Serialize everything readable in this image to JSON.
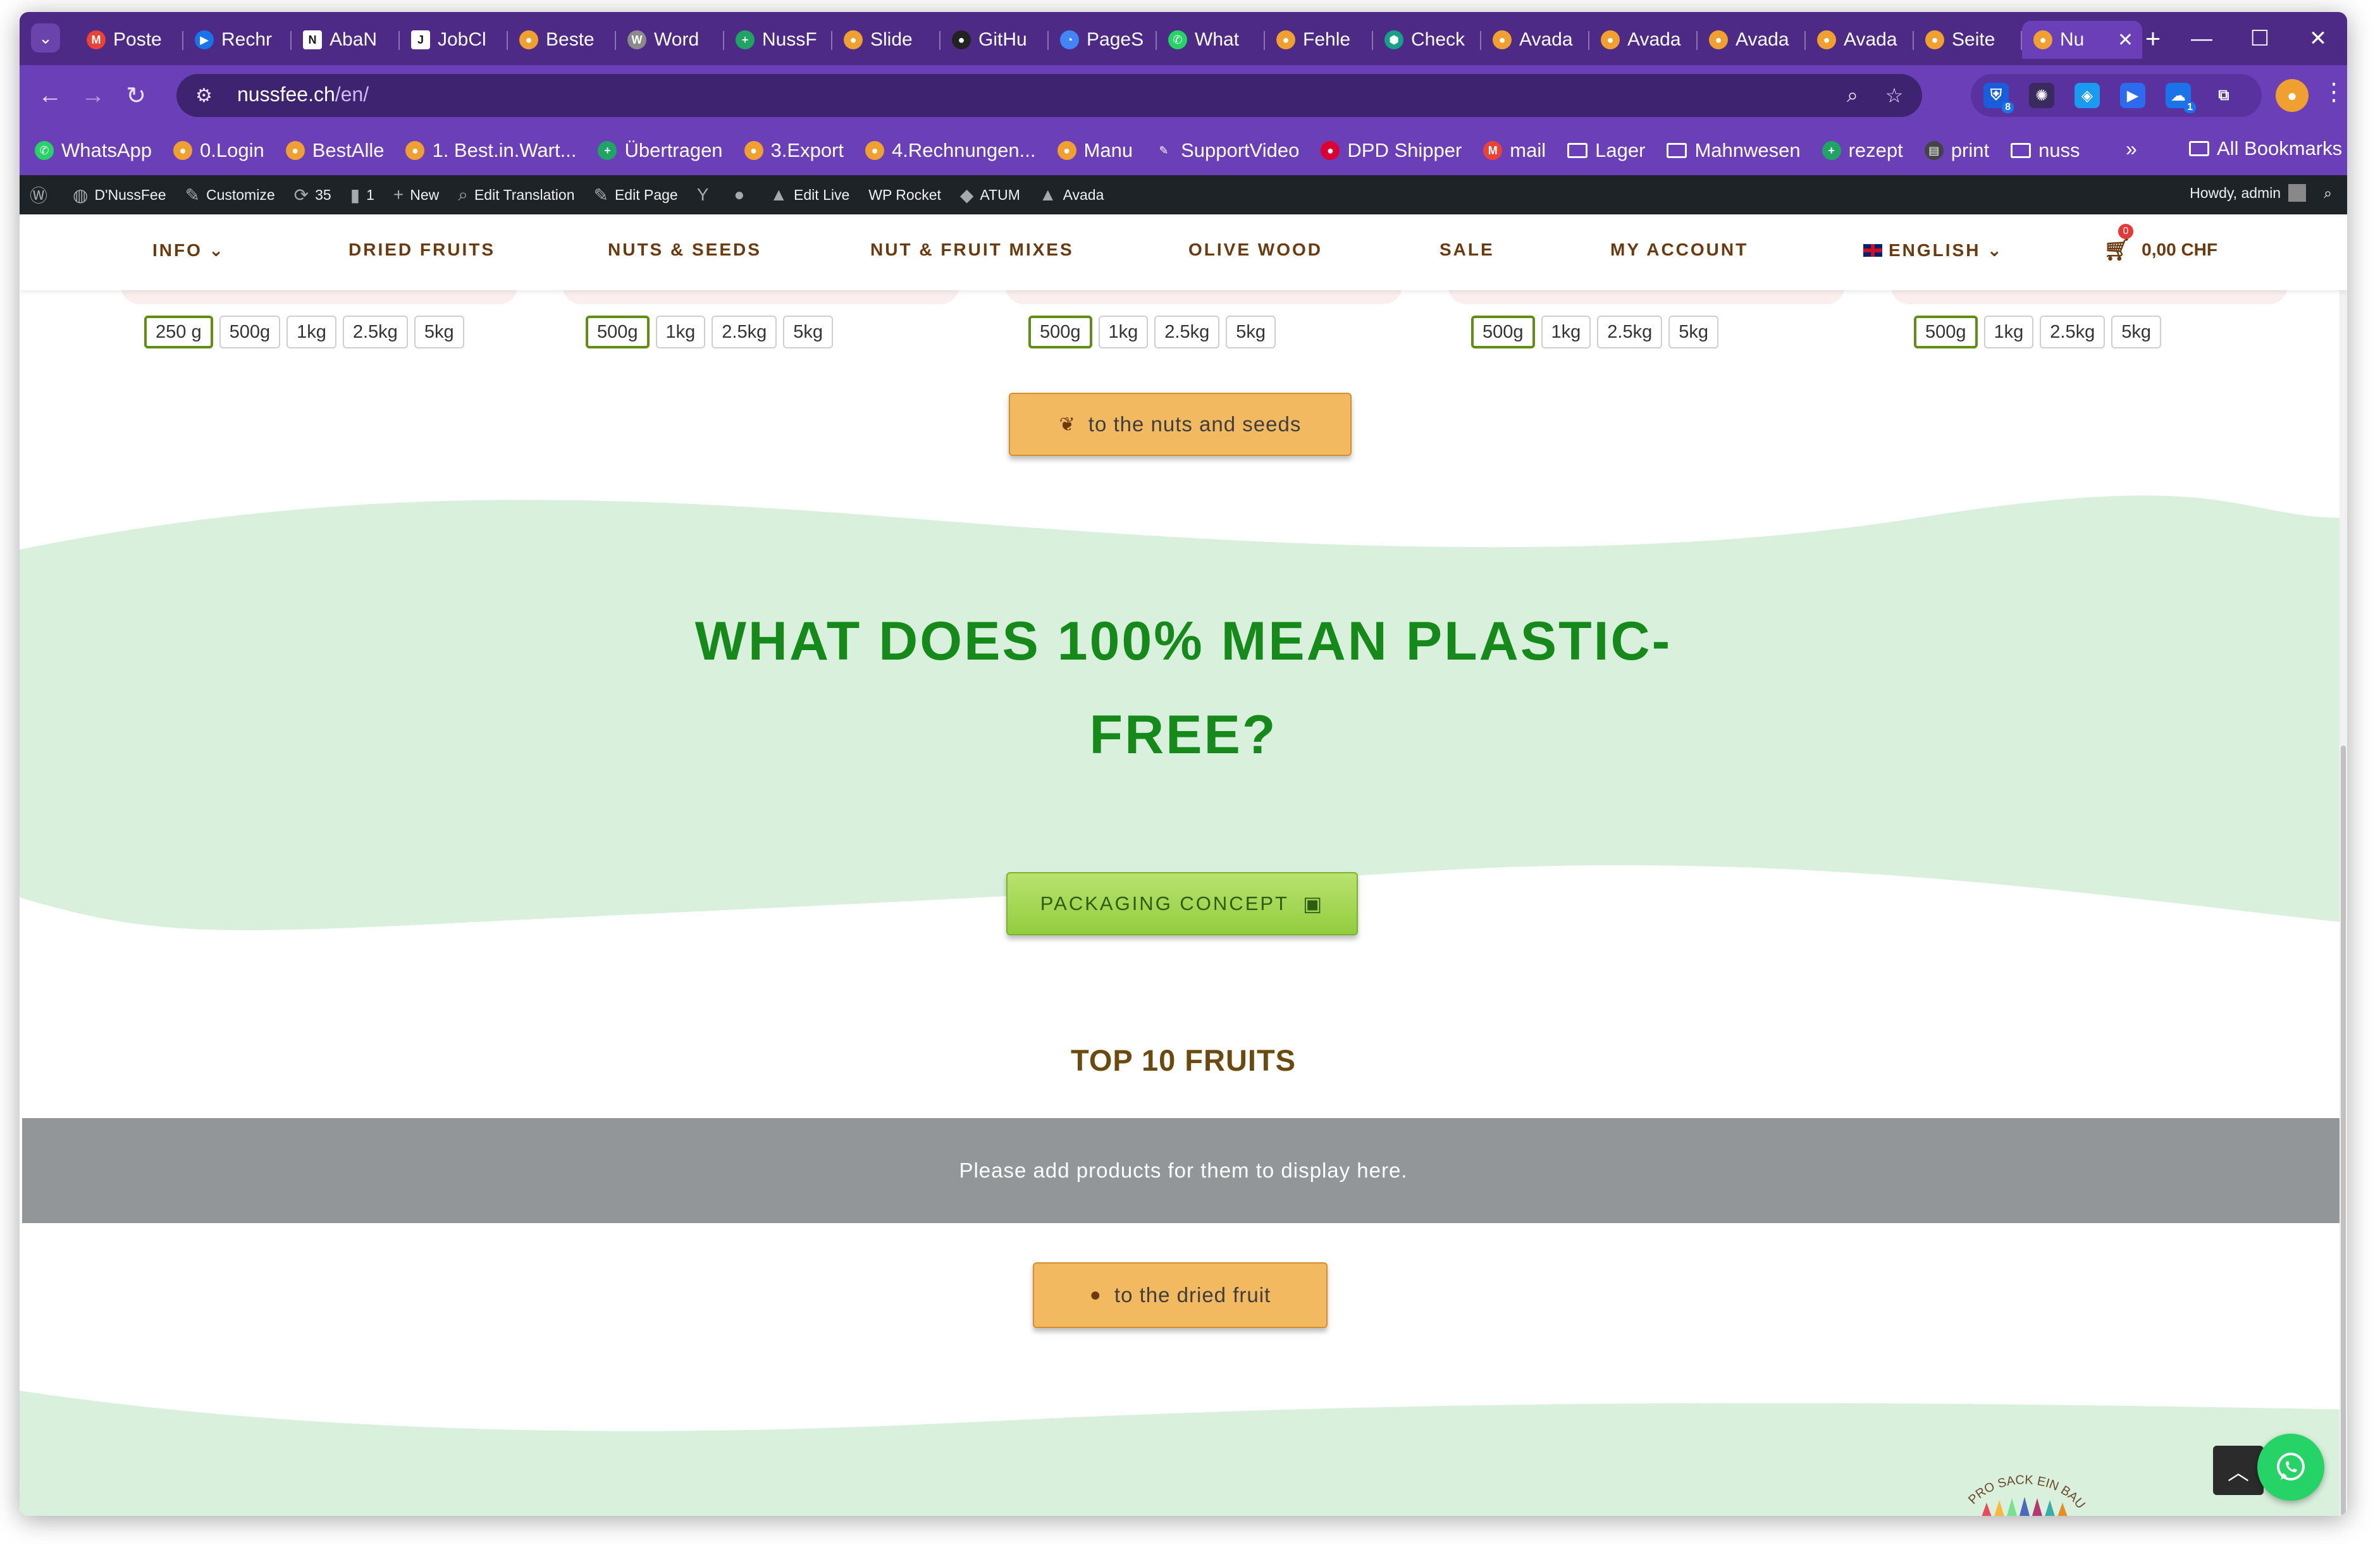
{
  "browser": {
    "tabs": [
      {
        "title": "Poste",
        "icon": "gmail-icon",
        "color": "#ea4335",
        "glyph": "M"
      },
      {
        "title": "Rechr",
        "icon": "arrow-app-icon",
        "color": "#1a73e8",
        "glyph": "▶"
      },
      {
        "title": "AbaN",
        "icon": "notion-icon",
        "color": "#ffffff",
        "glyph": "N"
      },
      {
        "title": "JobCl",
        "icon": "j-app-icon",
        "color": "#ffffff",
        "glyph": "J"
      },
      {
        "title": "Beste",
        "icon": "nussfee-icon",
        "color": "#f0a030",
        "glyph": "●"
      },
      {
        "title": "Word",
        "icon": "wordpress-icon",
        "color": "#8a8a8a",
        "glyph": "W"
      },
      {
        "title": "NussF",
        "icon": "sheets-plus-icon",
        "color": "#1fa463",
        "glyph": "+"
      },
      {
        "title": "Slide",
        "icon": "nussfee-icon",
        "color": "#f0a030",
        "glyph": "●"
      },
      {
        "title": "GitHu",
        "icon": "github-icon",
        "color": "#222222",
        "glyph": "●"
      },
      {
        "title": "PageS",
        "icon": "pagespeed-icon",
        "color": "#4285f4",
        "glyph": "◔"
      },
      {
        "title": "What",
        "icon": "whatsapp-icon",
        "color": "#25d366",
        "glyph": "✆"
      },
      {
        "title": "Fehle",
        "icon": "nussfee-icon",
        "color": "#f0a030",
        "glyph": "●"
      },
      {
        "title": "Check",
        "icon": "shield-app-icon",
        "color": "#16a085",
        "glyph": "⬢"
      },
      {
        "title": "Avada",
        "icon": "nussfee-icon",
        "color": "#f0a030",
        "glyph": "●"
      },
      {
        "title": "Avada",
        "icon": "nussfee-icon",
        "color": "#f0a030",
        "glyph": "●"
      },
      {
        "title": "Avada",
        "icon": "nussfee-icon",
        "color": "#f0a030",
        "glyph": "●"
      },
      {
        "title": "Avada",
        "icon": "nussfee-icon",
        "color": "#f0a030",
        "glyph": "●"
      },
      {
        "title": "Seite",
        "icon": "nussfee-icon",
        "color": "#f0a030",
        "glyph": "●"
      },
      {
        "title": "Nu",
        "icon": "nussfee-icon",
        "color": "#f0a030",
        "glyph": "●",
        "active": true
      }
    ],
    "url_host": "nussfee.ch",
    "url_path": "/en/",
    "extensions": [
      {
        "icon": "bitwarden-icon",
        "color": "#175ddc",
        "glyph": "⛨",
        "badge": "8"
      },
      {
        "icon": "fox-extension-icon",
        "color": "#3a2a60",
        "glyph": "✺",
        "badge": ""
      },
      {
        "icon": "tag-extension-icon",
        "color": "#1a9bf0",
        "glyph": "◈",
        "badge": ""
      },
      {
        "icon": "play-extension-icon",
        "color": "#2c6bed",
        "glyph": "▶",
        "badge": ""
      },
      {
        "icon": "cloud-extension-icon",
        "color": "#1a73e8",
        "glyph": "☁",
        "badge": "1"
      },
      {
        "icon": "puzzle-icon",
        "color": "#5a32a0",
        "glyph": "⧉",
        "badge": ""
      }
    ],
    "bookmarks": [
      {
        "label": "WhatsApp",
        "icon": "whatsapp-icon",
        "color": "#25d366",
        "glyph": "✆"
      },
      {
        "label": "0.Login",
        "icon": "nussfee-icon",
        "color": "#f0a030",
        "glyph": "●"
      },
      {
        "label": "BestAlle",
        "icon": "nussfee-icon",
        "color": "#f0a030",
        "glyph": "●"
      },
      {
        "label": "1. Best.in.Wart...",
        "icon": "nussfee-icon",
        "color": "#f0a030",
        "glyph": "●"
      },
      {
        "label": "Übertragen",
        "icon": "sheets-plus-icon",
        "color": "#1fa463",
        "glyph": "+"
      },
      {
        "label": "3.Export",
        "icon": "nussfee-icon",
        "color": "#f0a030",
        "glyph": "●"
      },
      {
        "label": "4.Rechnungen...",
        "icon": "nussfee-icon",
        "color": "#f0a030",
        "glyph": "●"
      },
      {
        "label": "Manu",
        "icon": "nussfee-icon",
        "color": "#f0a030",
        "glyph": "●"
      },
      {
        "label": "SupportVideo",
        "icon": "pen-icon",
        "color": "#6b3fb8",
        "glyph": "✎"
      },
      {
        "label": "DPD Shipper",
        "icon": "dpd-icon",
        "color": "#dc0032",
        "glyph": "●"
      },
      {
        "label": "mail",
        "icon": "gmail-icon",
        "color": "#ea4335",
        "glyph": "M"
      },
      {
        "label": "Lager",
        "icon": "folder-icon",
        "folder": true
      },
      {
        "label": "Mahnwesen",
        "icon": "folder-icon",
        "folder": true
      },
      {
        "label": "rezept",
        "icon": "sheets-plus-icon",
        "color": "#1fa463",
        "glyph": "+"
      },
      {
        "label": "print",
        "icon": "cups-icon",
        "color": "#444444",
        "glyph": "▤"
      },
      {
        "label": "nuss",
        "icon": "folder-icon",
        "folder": true
      }
    ],
    "all_bookmarks": "All Bookmarks"
  },
  "adminbar": {
    "items": [
      {
        "label": "D'NussFee",
        "icon": "dashboard-icon",
        "glyph": "◍"
      },
      {
        "label": "Customize",
        "icon": "brush-icon",
        "glyph": "✎"
      },
      {
        "label": "35",
        "icon": "updates-icon",
        "glyph": "⟳"
      },
      {
        "label": "1",
        "icon": "comment-icon",
        "glyph": "▮"
      },
      {
        "label": "New",
        "icon": "plus-icon",
        "glyph": "+"
      },
      {
        "label": "Edit Translation",
        "icon": "translate-icon",
        "glyph": "⌕"
      },
      {
        "label": "Edit Page",
        "icon": "pencil-icon",
        "glyph": "✎"
      },
      {
        "label": "",
        "icon": "yoast-icon",
        "glyph": "Y"
      },
      {
        "label": "",
        "icon": "status-dot-icon",
        "glyph": "●"
      },
      {
        "label": "Edit Live",
        "icon": "avada-icon",
        "glyph": "▲"
      },
      {
        "label": "WP Rocket",
        "icon": "",
        "glyph": ""
      },
      {
        "label": "ATUM",
        "icon": "atum-icon",
        "glyph": "◆"
      },
      {
        "label": "Avada",
        "icon": "avada-icon",
        "glyph": "▲"
      }
    ],
    "greeting": "Howdy, admin"
  },
  "site": {
    "nav": [
      {
        "label": "INFO",
        "dropdown": true
      },
      {
        "label": "DRIED FRUITS"
      },
      {
        "label": "NUTS & SEEDS"
      },
      {
        "label": "NUT & FRUIT MIXES"
      },
      {
        "label": "OLIVE WOOD"
      },
      {
        "label": "SALE"
      },
      {
        "label": "MY ACCOUNT"
      },
      {
        "label": "ENGLISH",
        "dropdown": true,
        "flag": true
      }
    ],
    "cart": {
      "count": "0",
      "total": "0,00 CHF"
    },
    "products": [
      {
        "variants": [
          "250 g",
          "500g",
          "1kg",
          "2.5kg",
          "5kg"
        ],
        "selected": 0
      },
      {
        "variants": [
          "500g",
          "1kg",
          "2.5kg",
          "5kg"
        ],
        "selected": 0
      },
      {
        "variants": [
          "500g",
          "1kg",
          "2.5kg",
          "5kg"
        ],
        "selected": 0
      },
      {
        "variants": [
          "500g",
          "1kg",
          "2.5kg",
          "5kg"
        ],
        "selected": 0
      },
      {
        "variants": [
          "500g",
          "1kg",
          "2.5kg",
          "5kg"
        ],
        "selected": 0
      }
    ],
    "nuts_button": "to the nuts and seeds",
    "headline_line1": "WHAT DOES 100% MEAN PLASTIC-",
    "headline_line2": "FREE?",
    "packaging_button": "PACKAGING CONCEPT",
    "top10_title": "TOP 10 FRUITS",
    "top10_notice": "Please add products for them to display here.",
    "fruit_button": "to the dried fruit",
    "colors": {
      "browser_purple": "#6b3fb8",
      "headline_green": "#158a1a",
      "wave_green": "#d9f0dc",
      "button_orange": "#f2b960",
      "nav_brown": "#6b3a0f"
    }
  }
}
